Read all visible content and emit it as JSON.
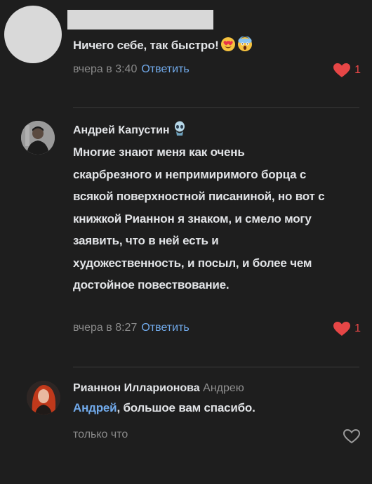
{
  "comments": [
    {
      "author": "",
      "text": "Ничего себе, так быстро!",
      "emojis": [
        "heart-eyes-emoji",
        "screaming-emoji"
      ],
      "time": "вчера в 3:40",
      "reply_label": "Ответить",
      "likes": "1",
      "liked": true
    },
    {
      "author": "Андрей Капустин",
      "badge_icon": "alien-badge-icon",
      "text": "Многие знают меня как очень скарбрезного и непримиримого борца с всякой поверхностной писаниной, но вот с книжкой Рианнон я знаком, и смело могу заявить, что в ней есть и художественность, и посыл, и более чем достойное повествование.",
      "time": "вчера в 8:27",
      "reply_label": "Ответить",
      "likes": "1",
      "liked": true
    },
    {
      "author": "Рианнон Илларионова",
      "reply_to": "Андрею",
      "mention": "Андрей",
      "text": ", большое вам спасибо.",
      "time": "только что",
      "liked": false
    }
  ],
  "colors": {
    "background": "#1e1e1e",
    "link": "#71aaeb",
    "like": "#e64646",
    "muted": "#8a8a8a"
  }
}
